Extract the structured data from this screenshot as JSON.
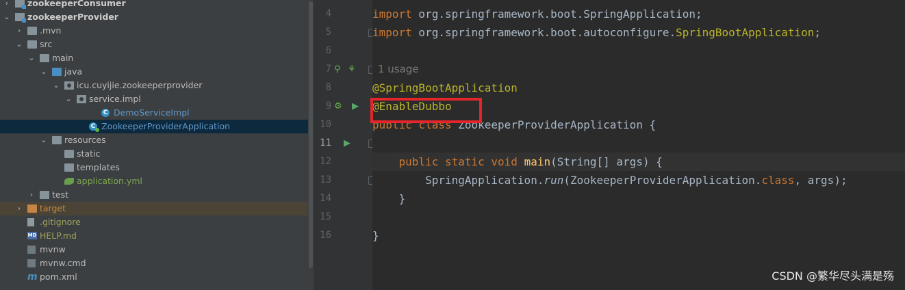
{
  "project_tree": [
    {
      "label": "zookeeperConsumer",
      "depth": 0,
      "arrow": "›",
      "icon": "module",
      "style": "bold"
    },
    {
      "label": "zookeeperProvider",
      "depth": 0,
      "arrow": "⌄",
      "icon": "module",
      "style": "bold"
    },
    {
      "label": ".mvn",
      "depth": 1,
      "arrow": "›",
      "icon": "folder",
      "style": "normal"
    },
    {
      "label": "src",
      "depth": 1,
      "arrow": "⌄",
      "icon": "folder",
      "style": "normal"
    },
    {
      "label": "main",
      "depth": 2,
      "arrow": "⌄",
      "icon": "folder",
      "style": "normal"
    },
    {
      "label": "java",
      "depth": 3,
      "arrow": "⌄",
      "icon": "folder-blue",
      "style": "normal"
    },
    {
      "label": "icu.cuyijie.zookeeperprovider",
      "depth": 4,
      "arrow": "⌄",
      "icon": "package",
      "style": "normal"
    },
    {
      "label": "service.impl",
      "depth": 5,
      "arrow": "⌄",
      "icon": "package",
      "style": "normal"
    },
    {
      "label": "DemoServiceImpl",
      "depth": 7,
      "arrow": "",
      "icon": "class",
      "style": "blue"
    },
    {
      "label": "ZookeeperProviderApplication",
      "depth": 6,
      "arrow": "",
      "icon": "class-run",
      "style": "blue",
      "selected": true
    },
    {
      "label": "resources",
      "depth": 3,
      "arrow": "⌄",
      "icon": "folder-res",
      "style": "normal"
    },
    {
      "label": "static",
      "depth": 4,
      "arrow": "",
      "icon": "folder",
      "style": "normal"
    },
    {
      "label": "templates",
      "depth": 4,
      "arrow": "",
      "icon": "folder",
      "style": "normal"
    },
    {
      "label": "application.yml",
      "depth": 4,
      "arrow": "",
      "icon": "yml",
      "style": "green"
    },
    {
      "label": "test",
      "depth": 2,
      "arrow": "›",
      "icon": "folder",
      "style": "normal"
    },
    {
      "label": "target",
      "depth": 1,
      "arrow": "›",
      "icon": "folder-orange",
      "style": "orange",
      "highlight": true
    },
    {
      "label": ".gitignore",
      "depth": 1,
      "arrow": "",
      "icon": "file",
      "style": "olive"
    },
    {
      "label": "HELP.md",
      "depth": 1,
      "arrow": "",
      "icon": "md",
      "style": "olive"
    },
    {
      "label": "mvnw",
      "depth": 1,
      "arrow": "",
      "icon": "terminal",
      "style": "normal"
    },
    {
      "label": "mvnw.cmd",
      "depth": 1,
      "arrow": "",
      "icon": "terminal",
      "style": "normal"
    },
    {
      "label": "pom.xml",
      "depth": 1,
      "arrow": "",
      "icon": "maven",
      "style": "normal"
    }
  ],
  "editor": {
    "line_numbers": [
      "4",
      "5",
      "6",
      "7",
      "8",
      "9",
      "10",
      "11",
      "12",
      "13",
      "14",
      "15",
      "16"
    ],
    "current_line": "11",
    "usage_hint": "1 usage",
    "code": {
      "l4_import": "import",
      "l4_rest": " org.springframework.boot.SpringApplication;",
      "l5_import": "import",
      "l5_pkg": " org.springframework.boot.autoconfigure.",
      "l5_cls": "SpringBootApplication",
      "l5_semi": ";",
      "l7_ann": "@SpringBootApplication",
      "l8_ann": "@EnableDubbo",
      "l9_mod": "public class",
      "l9_name": " ZookeeperProviderApplication {",
      "l11_indent": "    ",
      "l11_mods": "public static void",
      "l11_sp": " ",
      "l11_fn": "main",
      "l11_args": "(String[] args) {",
      "l12_indent": "        ",
      "l12_cls": "SpringApplication.",
      "l12_run": "run",
      "l12_open": "(ZookeeperProviderApplication.",
      "l12_class": "class",
      "l12_close": ", args);",
      "l13": "    }",
      "l15": "}"
    }
  },
  "watermark": "CSDN @繁华尽头满是殇",
  "colors": {
    "highlight_box": "#e5252a",
    "keyword": "#cc7832",
    "annotation": "#bbb529",
    "function": "#ffc66d"
  }
}
